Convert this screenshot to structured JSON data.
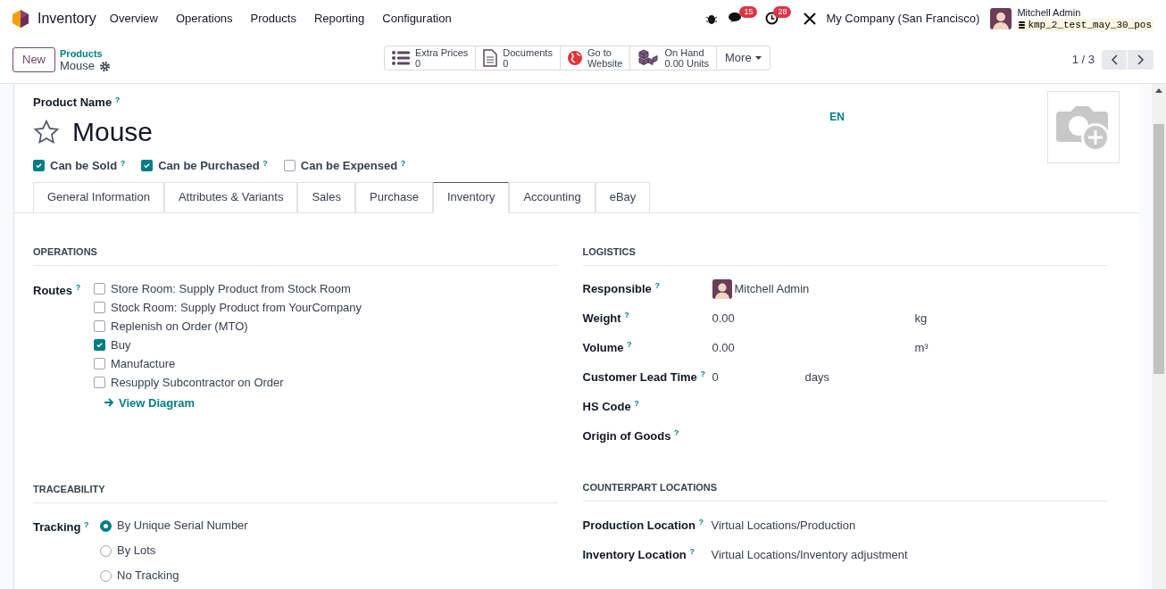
{
  "navbar": {
    "app_name": "Inventory",
    "menu": [
      "Overview",
      "Operations",
      "Products",
      "Reporting",
      "Configuration"
    ],
    "messages_count": "15",
    "activities_count": "28",
    "company": "My Company (San Francisco)",
    "user": "Mitchell Admin",
    "database": "kmp_2_test_may_30_pos"
  },
  "control_panel": {
    "new_button": "New",
    "breadcrumb": "Products",
    "record": "Mouse",
    "smart_buttons": [
      {
        "kind": "list",
        "label": "Extra Prices",
        "value": "0"
      },
      {
        "kind": "document",
        "label": "Documents",
        "value": "0"
      },
      {
        "kind": "globe",
        "label": "Go to",
        "value": "Website"
      },
      {
        "kind": "cubes",
        "label": "On Hand",
        "value": "0.00 Units"
      }
    ],
    "more": "More",
    "pager": "1 / 3"
  },
  "form": {
    "name_label": "Product Name $^{?}$",
    "name": "Mouse",
    "favorite": false,
    "language": "EN",
    "flags": [
      {
        "label": "Can be Sold $^{?}$",
        "checked": true
      },
      {
        "label": "Can be Purchased $^{?}$",
        "checked": true
      },
      {
        "label": "Can be Expensed $^{?}$",
        "checked": false
      }
    ],
    "tabs": [
      {
        "label": "General Information",
        "selected": false
      },
      {
        "label": "Attributes & Variants",
        "selected": false
      },
      {
        "label": "Sales",
        "selected": false
      },
      {
        "label": "Purchase",
        "selected": false
      },
      {
        "label": "Inventory",
        "selected": true
      },
      {
        "label": "Accounting",
        "selected": false
      },
      {
        "label": "eBay",
        "selected": false
      }
    ],
    "operations": {
      "title": "OPERATIONS",
      "routes_label": "Routes $^{?}$",
      "routes": [
        {
          "label": "Store Room: Supply Product from Stock Room",
          "checked": false
        },
        {
          "label": "Stock Room: Supply Product from YourCompany",
          "checked": false
        },
        {
          "label": "Replenish on Order (MTO)",
          "checked": false
        },
        {
          "label": "Buy",
          "checked": true
        },
        {
          "label": "Manufacture",
          "checked": false
        },
        {
          "label": "Resupply Subcontractor on Order",
          "checked": false
        }
      ],
      "view_diagram": "View Diagram"
    },
    "traceability": {
      "title": "TRACEABILITY",
      "tracking_label": "Tracking $^{?}$",
      "options": [
        {
          "label": "By Unique Serial Number",
          "selected": true
        },
        {
          "label": "By Lots",
          "selected": false
        },
        {
          "label": "No Tracking",
          "selected": false
        }
      ]
    },
    "logistics": {
      "title": "LOGISTICS",
      "fields": [
        {
          "kind": "user",
          "label": "Responsible $^{?}$",
          "value": "Mitchell Admin"
        },
        {
          "kind": "measure",
          "label": "Weight $^{?}$",
          "value": "0.00",
          "unit": "kg"
        },
        {
          "kind": "measure",
          "label": "Volume $^{?}$",
          "value": "0.00",
          "unit": "m³"
        },
        {
          "kind": "short",
          "label": "Customer Lead Time $^{?}$",
          "value": "0",
          "unit": "days"
        },
        {
          "kind": "empty",
          "label": "HS Code $^{?}$"
        },
        {
          "kind": "empty",
          "label": "Origin of Goods $^{?}$"
        }
      ]
    },
    "counterpart": {
      "title": "COUNTERPART LOCATIONS",
      "fields": [
        {
          "label": "Production Location $^{?}$",
          "value": "Virtual Locations/Production"
        },
        {
          "label": "Inventory Location $^{?}$",
          "value": "Virtual Locations/Inventory adjustment"
        }
      ]
    }
  }
}
